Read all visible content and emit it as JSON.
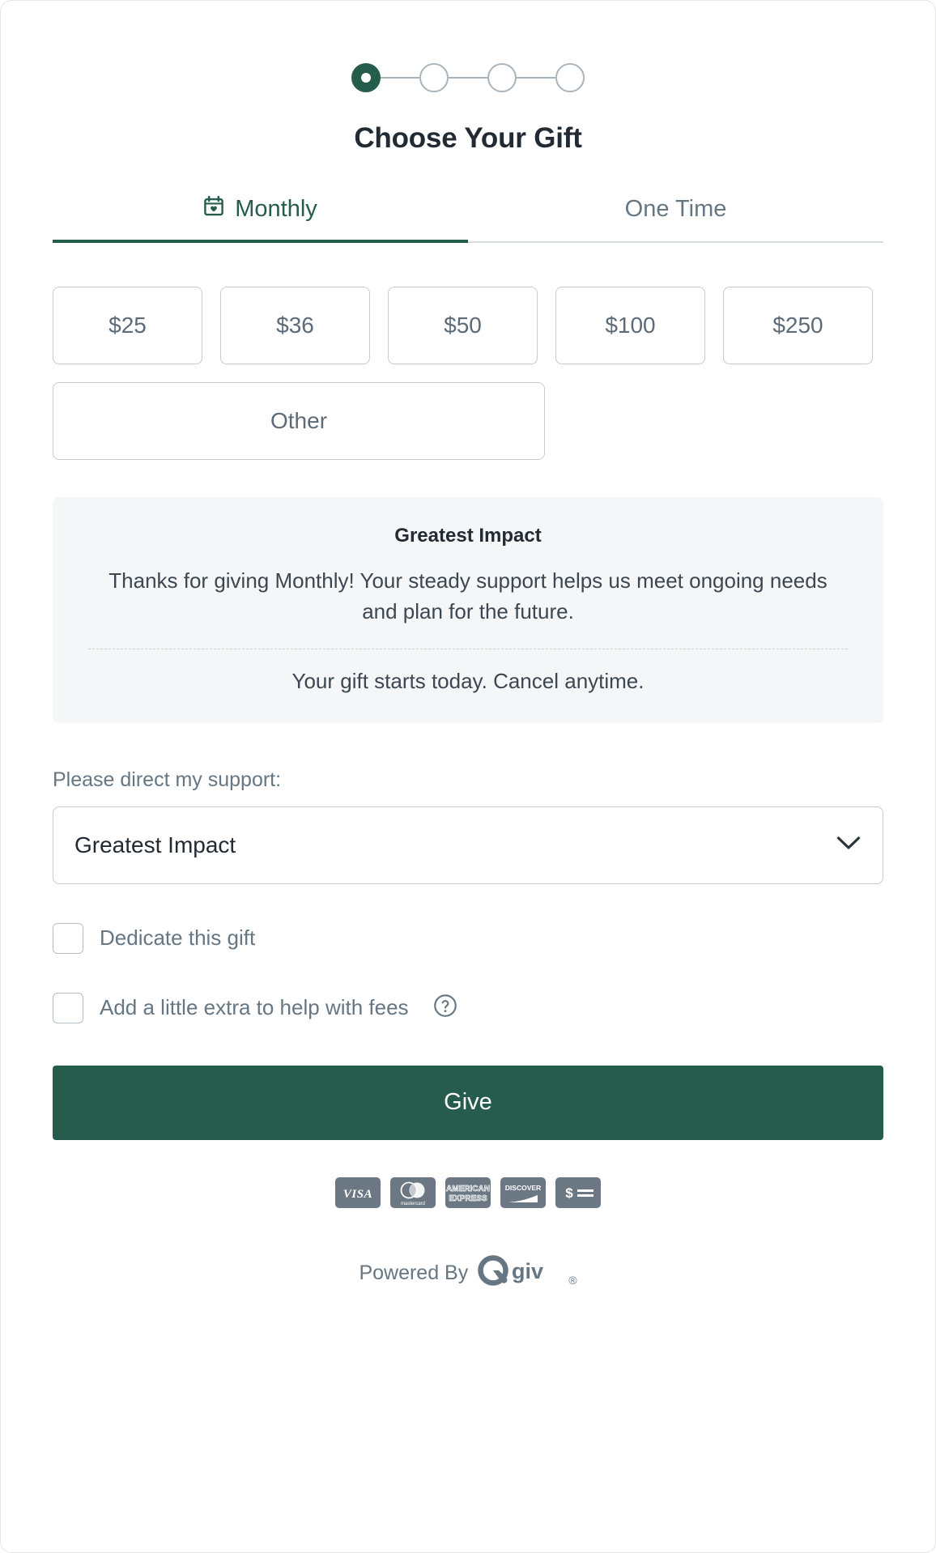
{
  "stepper": {
    "total_steps": 4,
    "current_step": 1,
    "active_color": "#265c4c",
    "inactive_color": "#a9b4bd"
  },
  "header": {
    "title": "Choose Your Gift"
  },
  "tabs": [
    {
      "label": "Monthly",
      "icon": "calendar-heart-icon",
      "active": true
    },
    {
      "label": "One Time",
      "icon": "",
      "active": false
    }
  ],
  "amounts": [
    {
      "label": "$25"
    },
    {
      "label": "$36"
    },
    {
      "label": "$50"
    },
    {
      "label": "$100"
    },
    {
      "label": "$250"
    },
    {
      "label": "Other"
    }
  ],
  "impact": {
    "title": "Greatest Impact",
    "body": "Thanks for giving Monthly! Your steady support helps us meet ongoing needs and plan for the future.",
    "note": "Your gift starts today. Cancel anytime."
  },
  "designation": {
    "label": "Please direct my support:",
    "selected": "Greatest Impact",
    "chevron_icon": "chevron-down-icon"
  },
  "options": {
    "dedicate": {
      "label": "Dedicate this gift",
      "checked": false
    },
    "cover_fees": {
      "label": "Add a little extra to help with fees",
      "checked": false,
      "help_icon": "question-circle-icon"
    }
  },
  "submit": {
    "label": "Give",
    "color": "#265c4c"
  },
  "payment_methods": [
    {
      "name": "visa-card-icon",
      "label": "VISA"
    },
    {
      "name": "mastercard-card-icon",
      "label": "mastercard"
    },
    {
      "name": "amex-card-icon",
      "label": "AMERICAN EXPRESS"
    },
    {
      "name": "discover-card-icon",
      "label": "DISCOVER"
    },
    {
      "name": "generic-card-icon",
      "label": ""
    }
  ],
  "footer": {
    "powered_by": "Powered By",
    "brand": "Qgiv",
    "registered_mark": "®"
  }
}
